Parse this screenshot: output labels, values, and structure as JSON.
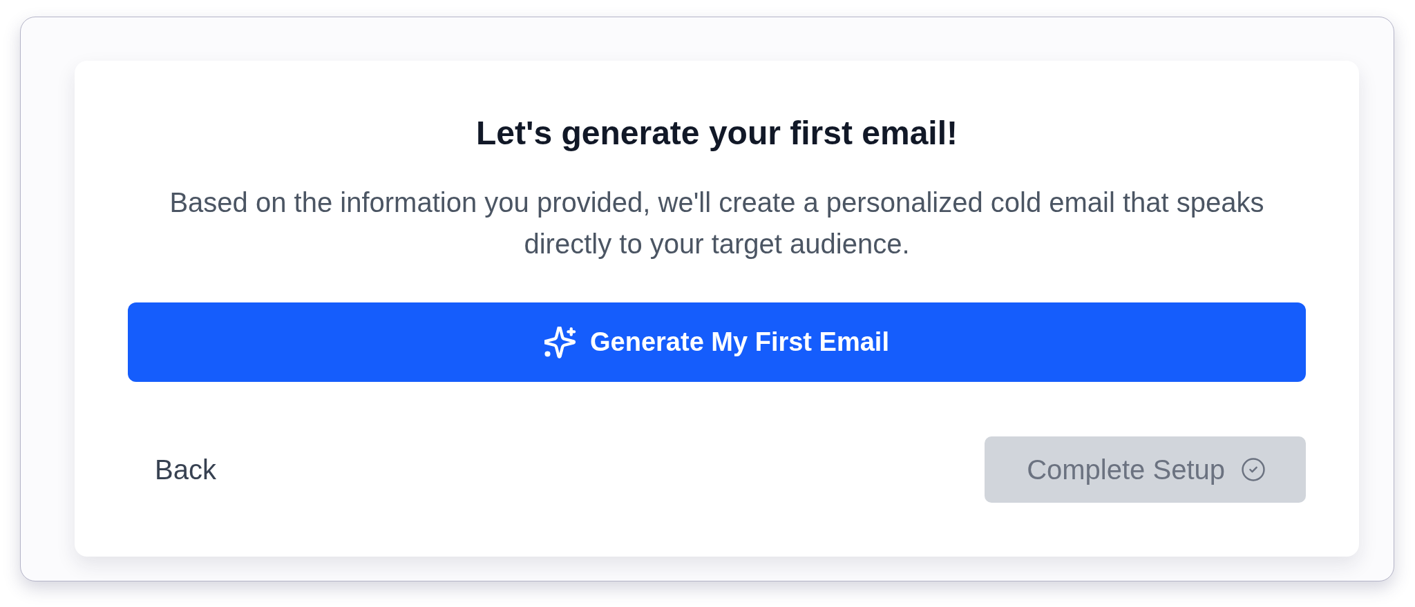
{
  "card": {
    "title": "Let's generate your first email!",
    "description": "Based on the information you provided, we'll create a personalized cold email that speaks directly to your target audience."
  },
  "primary_button": {
    "label": "Generate My First Email"
  },
  "footer": {
    "back_button": {
      "label": "Back"
    },
    "complete_button": {
      "label": "Complete Setup",
      "disabled": true
    }
  }
}
